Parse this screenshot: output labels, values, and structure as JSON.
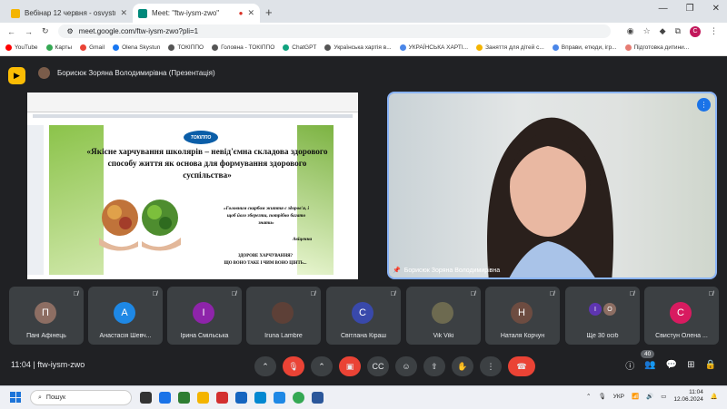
{
  "tabs": [
    {
      "title": "Вебінар 12 червня - osvystur",
      "active": false,
      "color": "#f4b400"
    },
    {
      "title": "Meet: \"ftw-iysm-zwo\"",
      "active": true,
      "color": "#00897b"
    }
  ],
  "url": "meet.google.com/ftw-iysm-zwo?pli=1",
  "bookmarks": [
    {
      "label": "YouTube",
      "color": "#ff0000"
    },
    {
      "label": "Карты",
      "color": "#34a853"
    },
    {
      "label": "Gmail",
      "color": "#ea4335"
    },
    {
      "label": "Olena Skystun",
      "color": "#1877f2"
    },
    {
      "label": "ТОКІППО",
      "color": "#555"
    },
    {
      "label": "Головна - ТОКІППО",
      "color": "#555"
    },
    {
      "label": "ChatGPT",
      "color": "#10a37f"
    },
    {
      "label": "Українська хартія в...",
      "color": "#555"
    },
    {
      "label": "УКРАЇНСЬКА ХАРТІ...",
      "color": "#4a86e8"
    },
    {
      "label": "Заняття для дітей с...",
      "color": "#f4b400"
    },
    {
      "label": "Вправи, етюди, ігр...",
      "color": "#4a86e8"
    },
    {
      "label": "Підготовка дитини...",
      "color": "#e67c73"
    }
  ],
  "meet": {
    "presenter_title": "Борисюк Зоряна Володимирівна (Презентація)",
    "speaker_name": "Борисюк Зоряна Володимирівна",
    "slide": {
      "logo": "ТОКІППО",
      "title": "«Якісне харчування школярів – невід'ємна складова здорового способу життя як основа для формування здорового суспільства»",
      "quote": "«Головним скарбом життя є здоров'я, і щоб його зберегти, потрібно багато знати»",
      "author": "Авіценна",
      "note1": "ЗДОРОВЕ ХАРЧУВАННЯ?",
      "note2": "ЩО ВОНО ТАКЕ І ЧИМ ВОНО ЦІНТЬ..."
    },
    "participants": [
      {
        "initial": "П",
        "name": "Пані Афінець",
        "color": "#8d6e63"
      },
      {
        "initial": "А",
        "name": "Анастасія Шевч...",
        "color": "#1e88e5"
      },
      {
        "initial": "І",
        "name": "Ірина Смільська",
        "color": "#8e24aa"
      },
      {
        "initial": "",
        "name": "Iruna Lambre",
        "color": "#5d4037"
      },
      {
        "initial": "С",
        "name": "Світлана Кіраш",
        "color": "#3949ab"
      },
      {
        "initial": "",
        "name": "Vik Viki",
        "color": "#6d6a50"
      },
      {
        "initial": "Н",
        "name": "Наталя Корчун",
        "color": "#6d4c41"
      },
      {
        "initial": "",
        "name": "Ще 30 осіб",
        "color": "#5e35b1"
      },
      {
        "initial": "С",
        "name": "Свистун Олена ...",
        "color": "#d81b60"
      }
    ],
    "more_initials": [
      "І",
      "О"
    ],
    "time": "11:04",
    "meeting_code": "ftw-iysm-zwo",
    "people_count": "40"
  },
  "taskbar": {
    "search": "Пошук",
    "lang": "УКР",
    "time": "11:04",
    "date": "12.06.2024"
  }
}
